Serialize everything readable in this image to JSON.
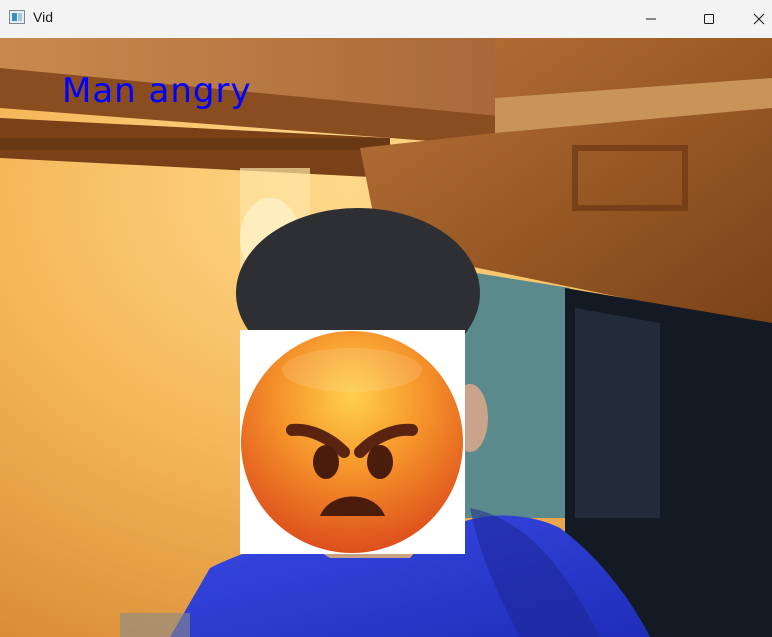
{
  "window": {
    "title": "Vid",
    "icon": "app-window-icon",
    "controls": [
      "minimize-icon",
      "maximize-icon",
      "close-icon"
    ]
  },
  "video": {
    "overlay_text": "Man angry",
    "overlay_color": "#0000ff",
    "face_mask": "angry-face-emoji"
  }
}
